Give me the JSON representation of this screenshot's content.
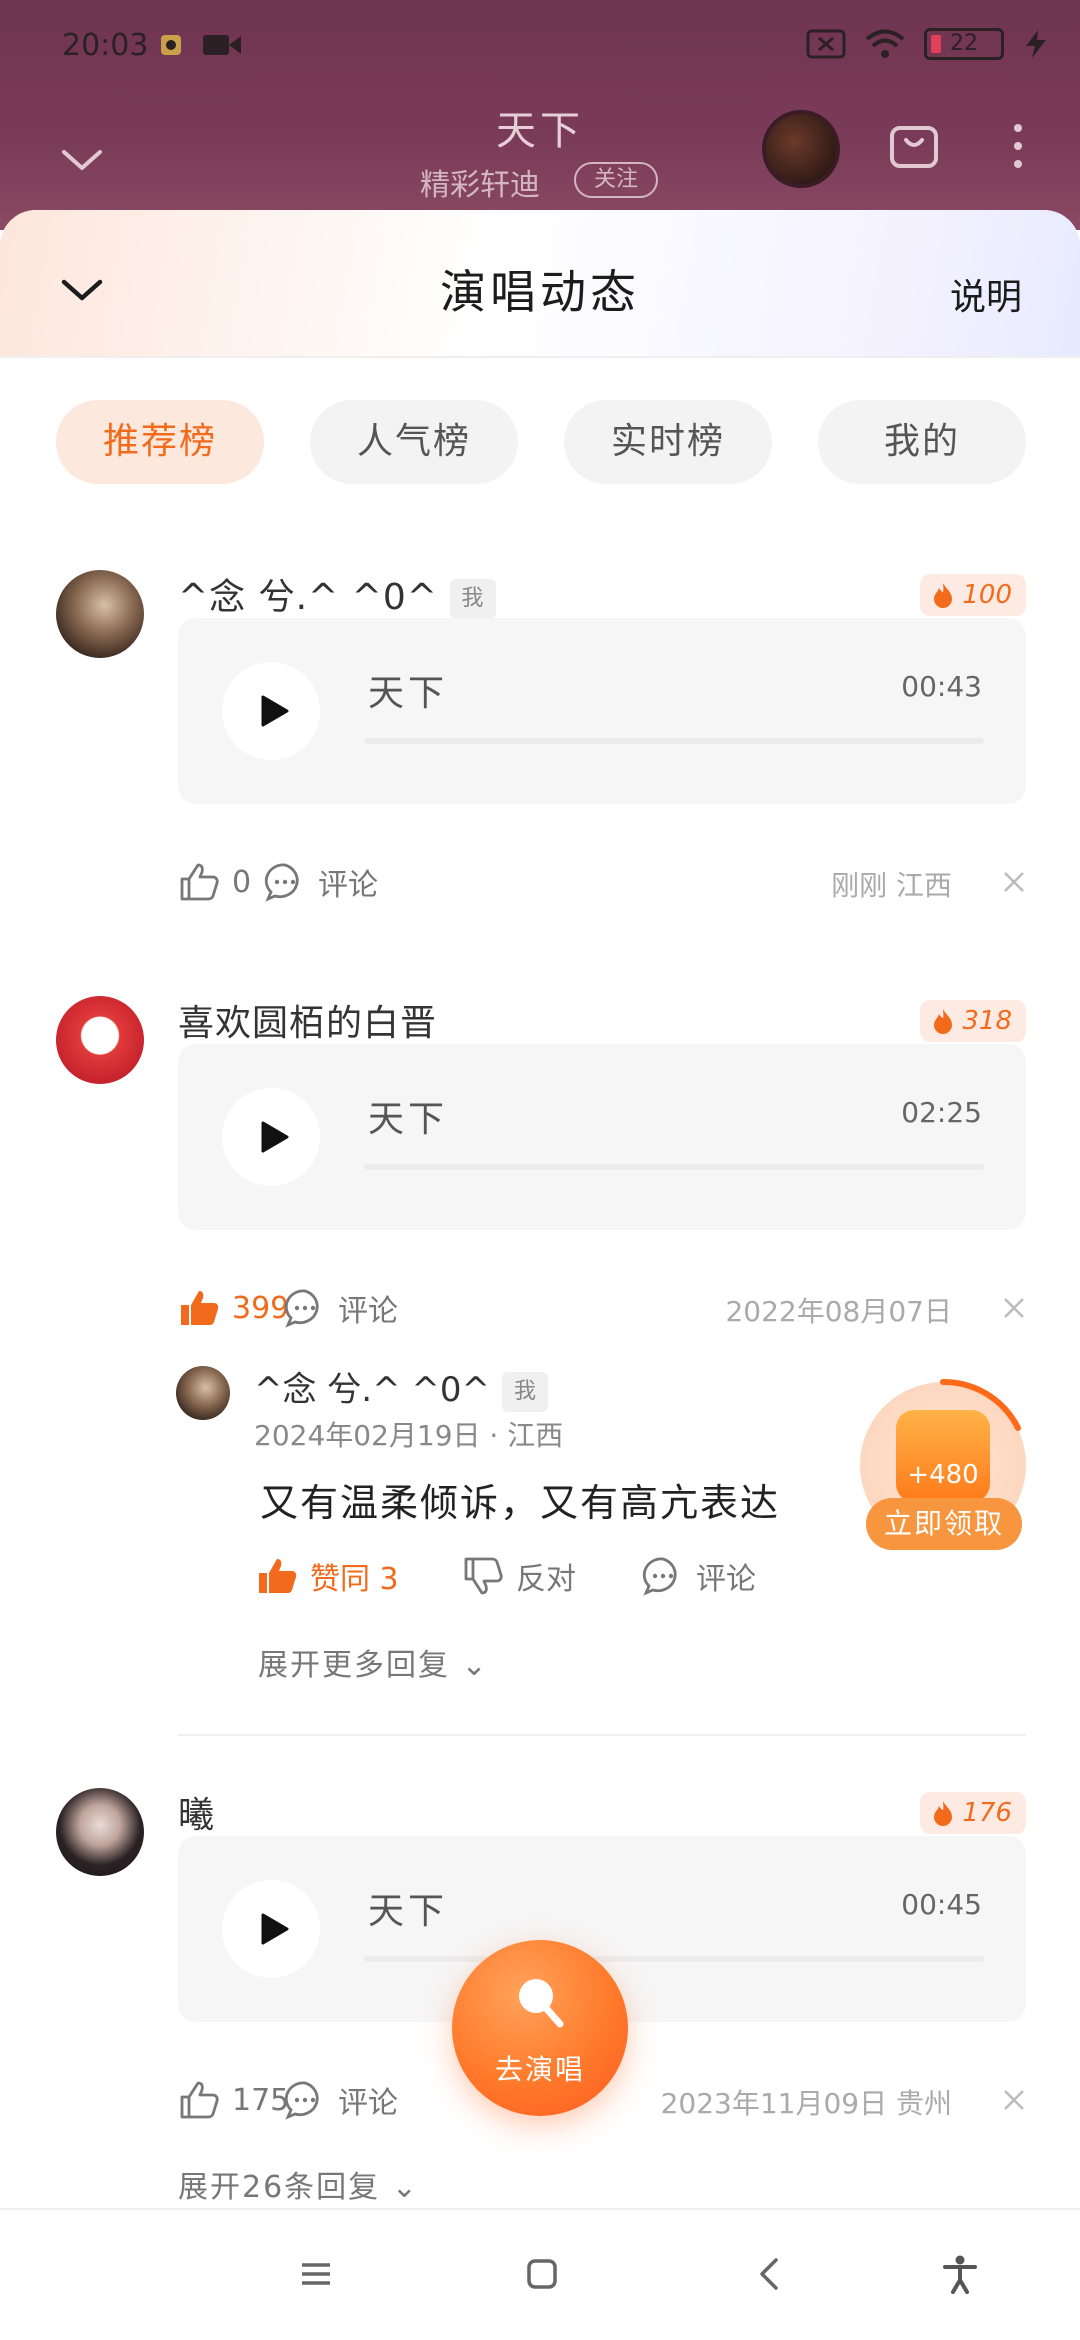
{
  "status_bar": {
    "time": "20:03",
    "battery": "22"
  },
  "player": {
    "song_title": "天下",
    "artist": "精彩轩迪",
    "follow_label": "关注"
  },
  "sheet": {
    "title": "演唱动态",
    "help_label": "说明",
    "tabs": [
      {
        "label": "推荐榜",
        "active": true
      },
      {
        "label": "人气榜",
        "active": false
      },
      {
        "label": "实时榜",
        "active": false
      },
      {
        "label": "我的",
        "active": false
      }
    ]
  },
  "entries": [
    {
      "user": "^念 兮.^ ^0^",
      "me_tag": "我",
      "heat": "100",
      "track": "天下",
      "duration": "00:43",
      "likes": "0",
      "comment_label": "评论",
      "meta": "刚刚 江西"
    },
    {
      "user": "喜欢圆栢的白晋",
      "heat": "318",
      "track": "天下",
      "duration": "02:25",
      "likes": "399",
      "comment_label": "评论",
      "meta": "2022年08月07日",
      "reply": {
        "user": "^念 兮.^ ^0^",
        "me_tag": "我",
        "meta": "2024年02月19日 · 江西",
        "text": "又有温柔倾诉，又有高亢表达",
        "agree_label": "赞同 3",
        "oppose_label": "反对",
        "comment_label": "评论"
      },
      "expand_label": "展开更多回复"
    },
    {
      "user": "曦",
      "heat": "176",
      "track": "天下",
      "duration": "00:45",
      "likes": "175",
      "comment_label": "评论",
      "meta": "2023年11月09日 贵州",
      "expand_label": "展开26条回复"
    }
  ],
  "reward": {
    "value": "+480",
    "button_label": "立即领取"
  },
  "fab": {
    "label": "去演唱"
  },
  "colors": {
    "accent": "#f26b1d",
    "tab_active_bg": "#fde8dd",
    "player_bg": "#7a3b58"
  }
}
